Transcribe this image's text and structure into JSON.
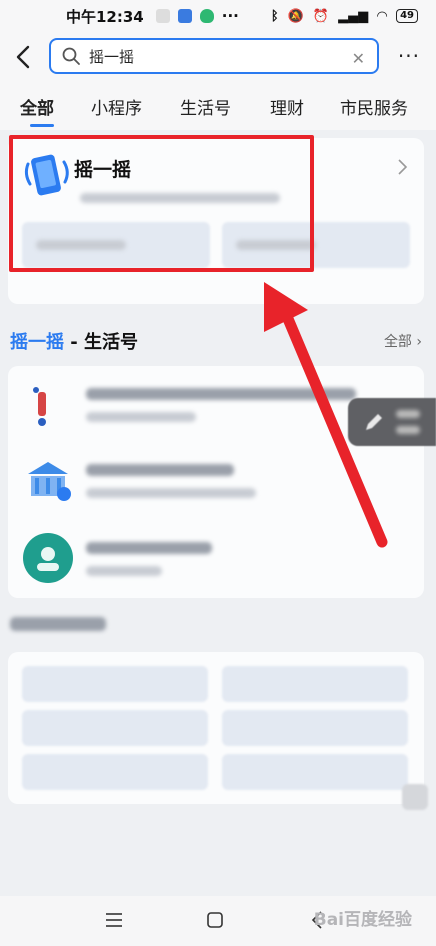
{
  "status_bar": {
    "time": "中午12:34",
    "dots": "···",
    "battery": "49"
  },
  "search": {
    "query": "摇一摇",
    "placeholder": ""
  },
  "tabs": [
    {
      "label": "全部"
    },
    {
      "label": "小程序"
    },
    {
      "label": "生活号"
    },
    {
      "label": "理财"
    },
    {
      "label": "市民服务"
    }
  ],
  "mini_program": {
    "title": "摇一摇"
  },
  "section": {
    "title_highlight": "摇一摇",
    "title_rest": " - 生活号",
    "all_label": "全部"
  },
  "colors": {
    "accent": "#2b7bf0",
    "annotation_red": "#e8232a",
    "teal_avatar": "#1f9e8e"
  },
  "watermark": "Bai百度经验"
}
